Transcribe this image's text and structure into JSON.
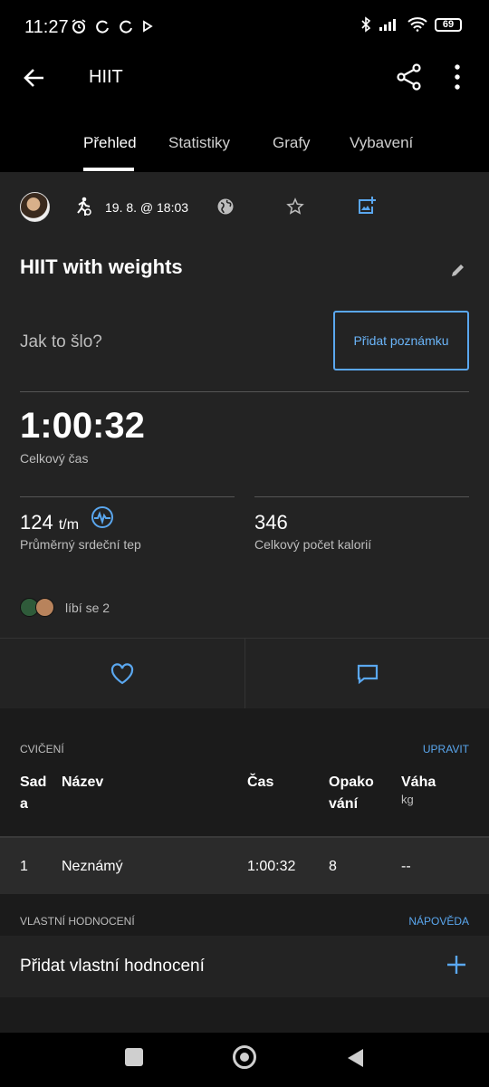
{
  "status": {
    "time": "11:27",
    "battery": "69"
  },
  "appbar": {
    "title": "HIIT"
  },
  "tabs": [
    {
      "label": "Přehled"
    },
    {
      "label": "Statistiky"
    },
    {
      "label": "Grafy"
    },
    {
      "label": "Vybavení"
    }
  ],
  "meta": {
    "date": "19. 8. @ 18:03"
  },
  "workout": {
    "title": "HIIT with weights",
    "how_placeholder": "Jak to šlo?",
    "add_note": "Přidat poznámku"
  },
  "summary": {
    "total_time": "1:00:32",
    "total_time_label": "Celkový čas",
    "avg_hr_value": "124",
    "avg_hr_unit": "t/m",
    "avg_hr_label": "Průměrný srdeční tep",
    "calories_value": "346",
    "calories_label": "Celkový počet kalorií"
  },
  "likes": {
    "text": "líbí se 2"
  },
  "exercises": {
    "section_label": "CVIČENÍ",
    "edit_label": "UPRAVIT",
    "headers": {
      "set": "Sad\na",
      "name": "Název",
      "time": "Čas",
      "reps": "Opako\nvání",
      "weight": "Váha",
      "weight_unit": "kg"
    },
    "rows": [
      {
        "set": "1",
        "name": "Neznámý",
        "time": "1:00:32",
        "reps": "8",
        "weight": "--"
      }
    ]
  },
  "rating": {
    "section_label": "VLASTNÍ HODNOCENÍ",
    "help_label": "NÁPOVĚDA",
    "add_label": "Přidat vlastní hodnocení"
  },
  "colors": {
    "accent": "#5aa7ef",
    "background": "#000000",
    "card": "#232323"
  }
}
